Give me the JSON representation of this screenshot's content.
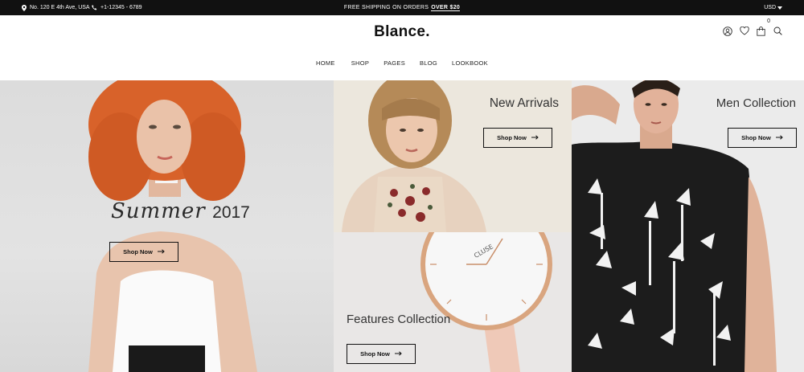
{
  "topbar": {
    "address": "No. 120 E 4th Ave, USA",
    "phone": "+1-12345 - 6789",
    "shipping_prefix": "FREE SHIPPING ON ORDERS",
    "shipping_highlight": "OVER $20",
    "currency": "USD"
  },
  "header": {
    "logo": "Blance.",
    "cart_count": "0"
  },
  "nav": {
    "items": [
      {
        "label": "HOME"
      },
      {
        "label": "SHOP"
      },
      {
        "label": "PAGES"
      },
      {
        "label": "BLOG"
      },
      {
        "label": "LOOKBOOK"
      }
    ]
  },
  "banners": {
    "summer": {
      "title_script": "Summer",
      "title_year": "2017",
      "button": "Shop Now"
    },
    "new_arrivals": {
      "title": "New Arrivals",
      "button": "Shop Now"
    },
    "features": {
      "title": "Features Collection",
      "button": "Shop Now",
      "watch_brand": "CLUSE"
    },
    "men": {
      "title": "Men Collection",
      "button": "Shop Now"
    }
  },
  "colors": {
    "topbar_bg": "#111111",
    "accent": "#111111",
    "hair_orange": "#d8622a",
    "watch_rose": "#e6b8a2"
  },
  "icons": [
    "location-icon",
    "phone-icon",
    "chevron-down-icon",
    "user-icon",
    "heart-icon",
    "bag-icon",
    "search-icon",
    "arrow-right-icon"
  ]
}
